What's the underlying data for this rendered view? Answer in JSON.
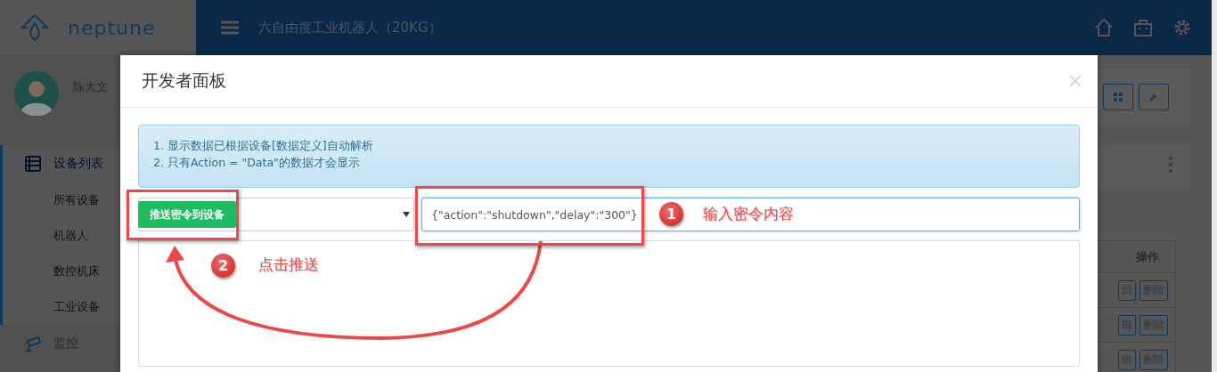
{
  "app": {
    "brand": "neptune",
    "title": "六自由度工业机器人（20KG）",
    "user": "陈大文"
  },
  "sidebar": {
    "items": [
      {
        "label": "设备列表",
        "kind": "group",
        "selected": true,
        "children": [
          {
            "label": "所有设备",
            "selected": false
          },
          {
            "label": "机器人",
            "selected": false
          },
          {
            "label": "数控机床",
            "selected": false
          },
          {
            "label": "工业设备",
            "selected": false
          }
        ]
      },
      {
        "label": "监控",
        "kind": "group",
        "selected": false
      }
    ]
  },
  "background_table": {
    "columns": [
      "操作"
    ],
    "rows": [
      {
        "actions": [
          "辑",
          "删除"
        ]
      },
      {
        "actions": [
          "辑",
          "删除"
        ]
      },
      {
        "actions": [
          "辑",
          "删除"
        ]
      }
    ]
  },
  "dialog": {
    "title": "开发者面板",
    "notices": [
      "1. 显示数据已根据设备[数据定义]自动解析",
      "2. 只有Action = \"Data\"的数据才会显示"
    ],
    "push_button": "推送密令到设备",
    "command_input": {
      "value": "{\"action\":\"shutdown\",\"delay\":\"300\"}"
    }
  },
  "annotations": [
    {
      "number": "1",
      "text": "输入密令内容"
    },
    {
      "number": "2",
      "text": "点击推送"
    }
  ]
}
